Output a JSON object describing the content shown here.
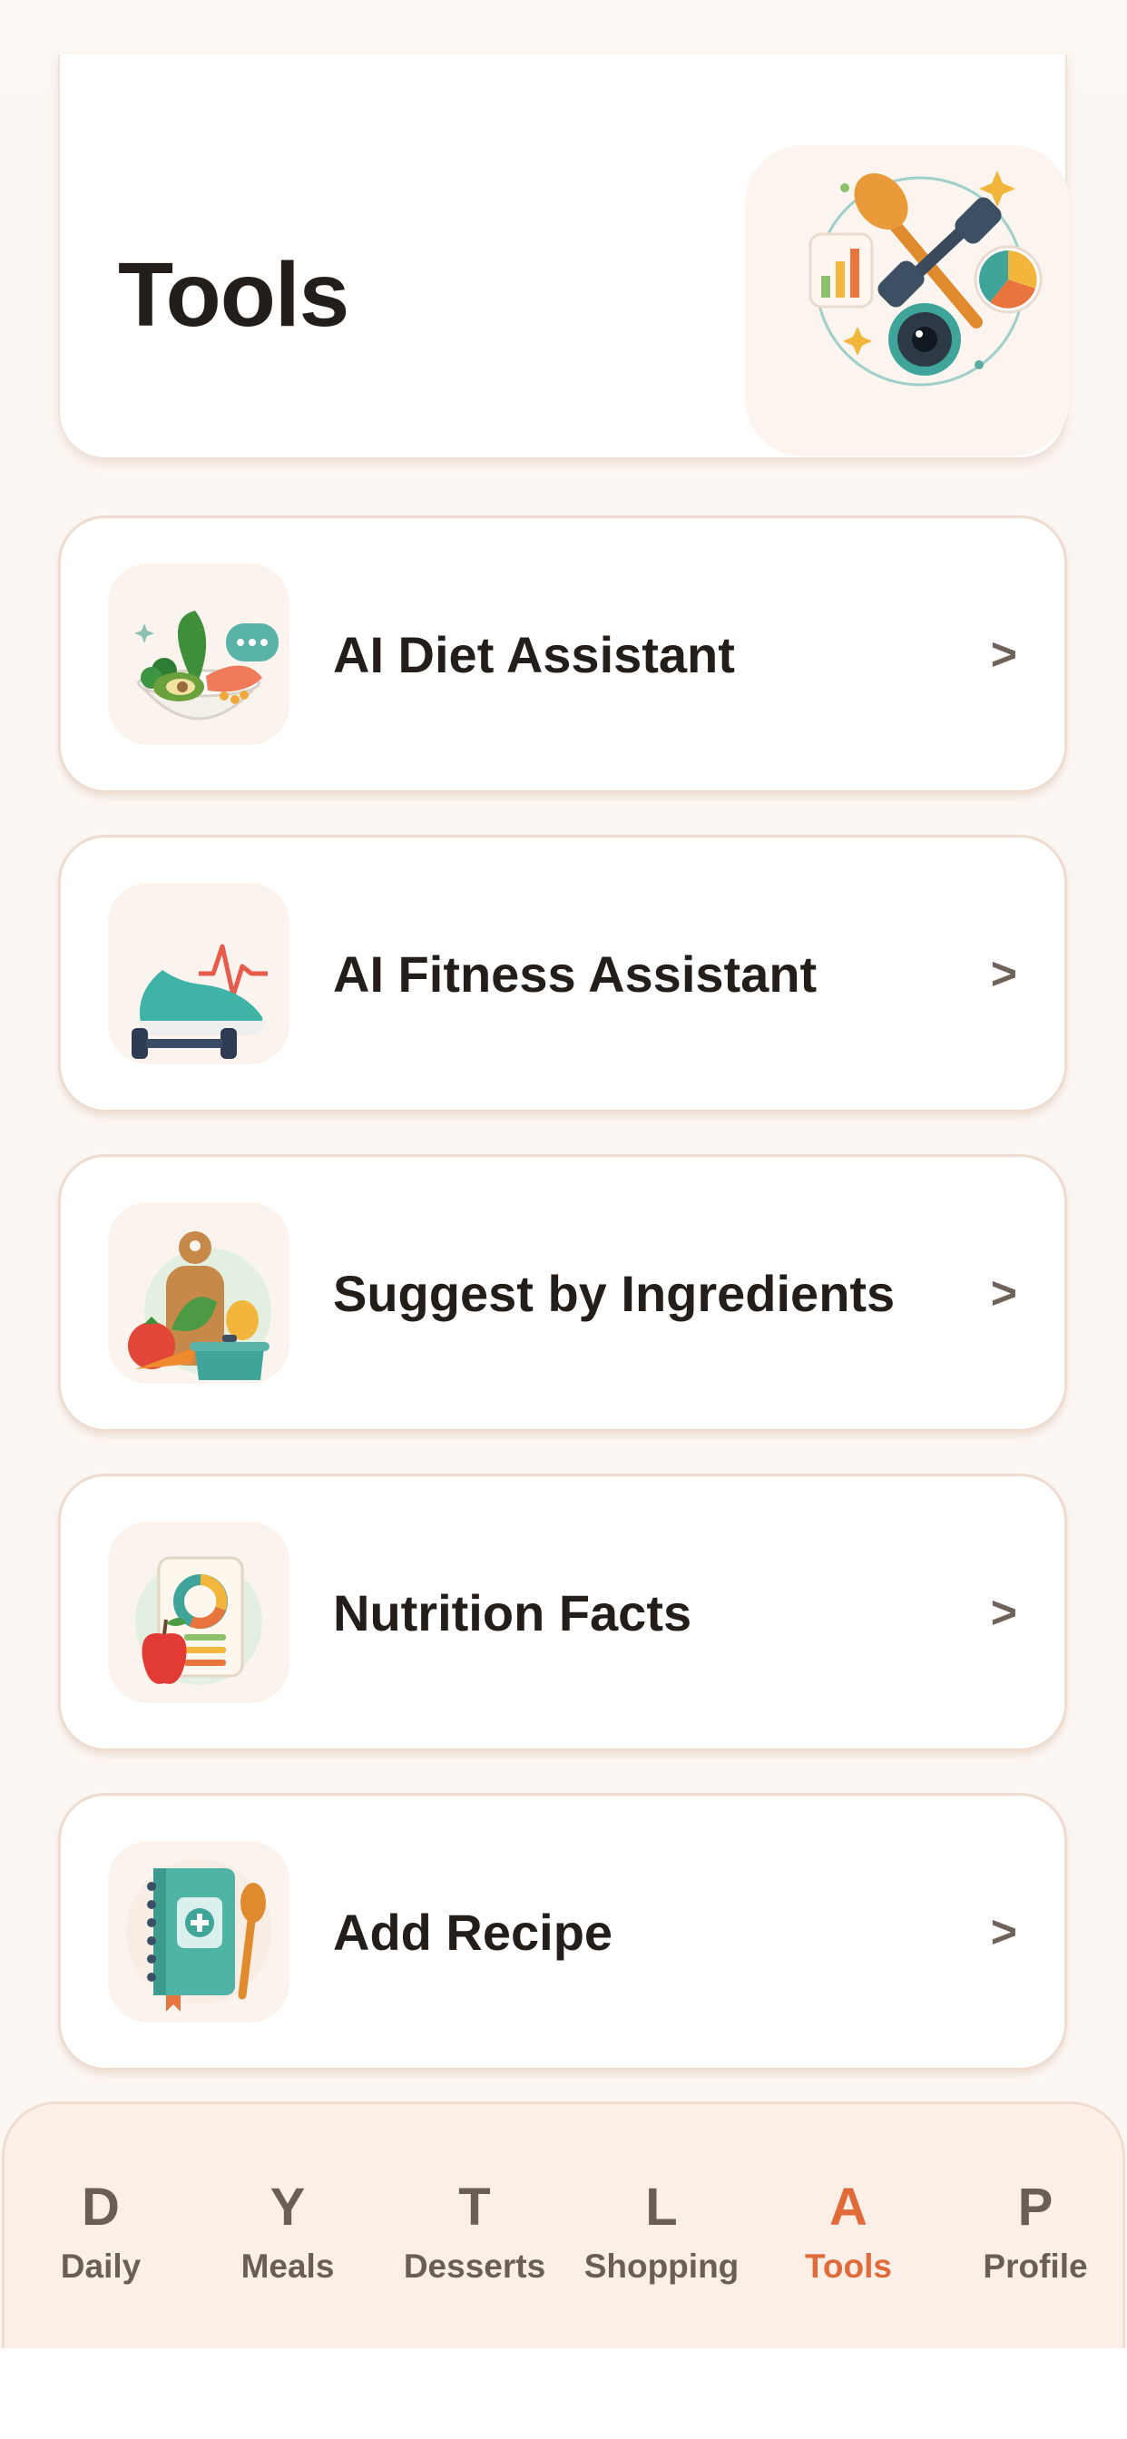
{
  "header": {
    "title": "Tools",
    "illustration": "tools-collage-icon"
  },
  "tools": [
    {
      "label": "AI Diet Assistant",
      "icon": "diet-bowl-icon",
      "chevron": ">"
    },
    {
      "label": "AI Fitness Assistant",
      "icon": "fitness-shoe-icon",
      "chevron": ">"
    },
    {
      "label": "Suggest by Ingredients",
      "icon": "ingredients-icon",
      "chevron": ">"
    },
    {
      "label": "Nutrition Facts",
      "icon": "nutrition-report-icon",
      "chevron": ">"
    },
    {
      "label": "Add Recipe",
      "icon": "recipe-book-icon",
      "chevron": ">"
    }
  ],
  "tabbar": {
    "items": [
      {
        "letter": "D",
        "label": "Daily"
      },
      {
        "letter": "Y",
        "label": "Meals"
      },
      {
        "letter": "T",
        "label": "Desserts"
      },
      {
        "letter": "L",
        "label": "Shopping"
      },
      {
        "letter": "A",
        "label": "Tools"
      },
      {
        "letter": "P",
        "label": "Profile"
      }
    ],
    "active": "Tools",
    "active_color": "#e06a38",
    "inactive_color": "#6b5e57"
  },
  "colors": {
    "background": "#fdf7f3",
    "card": "#ffffff",
    "text": "#241e1b"
  }
}
